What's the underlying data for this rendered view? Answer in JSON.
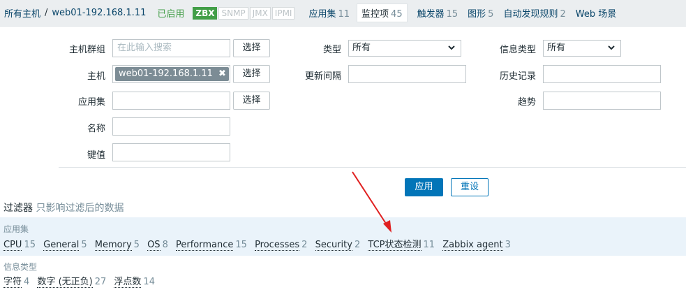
{
  "breadcrumb": {
    "all_hosts": "所有主机",
    "separator": "/",
    "host": "web01-192.168.1.11",
    "status": "已启用"
  },
  "availability": [
    "ZBX",
    "SNMP",
    "JMX",
    "IPMI"
  ],
  "nav": [
    {
      "label": "应用集",
      "count": "11"
    },
    {
      "label": "监控项",
      "count": "45"
    },
    {
      "label": "触发器",
      "count": "15"
    },
    {
      "label": "图形",
      "count": "5"
    },
    {
      "label": "自动发现规则",
      "count": "2"
    },
    {
      "label": "Web 场景",
      "count": ""
    }
  ],
  "filter": {
    "host_group_label": "主机群组",
    "host_group_placeholder": "在此输入搜索",
    "host_label": "主机",
    "host_tag": "web01-192.168.1.11",
    "application_label": "应用集",
    "name_label": "名称",
    "key_label": "键值",
    "select_label": "选择",
    "type_label": "类型",
    "type_value": "所有",
    "interval_label": "更新间隔",
    "info_type_label": "信息类型",
    "info_type_value": "所有",
    "history_label": "历史记录",
    "trends_label": "趋势",
    "apply_label": "应用",
    "reset_label": "重设"
  },
  "subfilter": {
    "title": "过滤器",
    "hint": "只影响过滤后的数据",
    "applications_head": "应用集",
    "applications": [
      {
        "name": "CPU",
        "count": "15"
      },
      {
        "name": "General",
        "count": "5"
      },
      {
        "name": "Memory",
        "count": "5"
      },
      {
        "name": "OS",
        "count": "8"
      },
      {
        "name": "Performance",
        "count": "15"
      },
      {
        "name": "Processes",
        "count": "2"
      },
      {
        "name": "Security",
        "count": "2"
      },
      {
        "name": "TCP状态检测",
        "count": "11"
      },
      {
        "name": "Zabbix agent",
        "count": "3"
      }
    ],
    "info_types_head": "信息类型",
    "info_types": [
      {
        "name": "字符",
        "count": "4"
      },
      {
        "name": "数字 (无正负)",
        "count": "27"
      },
      {
        "name": "浮点数",
        "count": "14"
      }
    ]
  },
  "colors": {
    "accent": "#0275b8",
    "enabled_green": "#429e47",
    "annotation_arrow": "#e02020"
  }
}
